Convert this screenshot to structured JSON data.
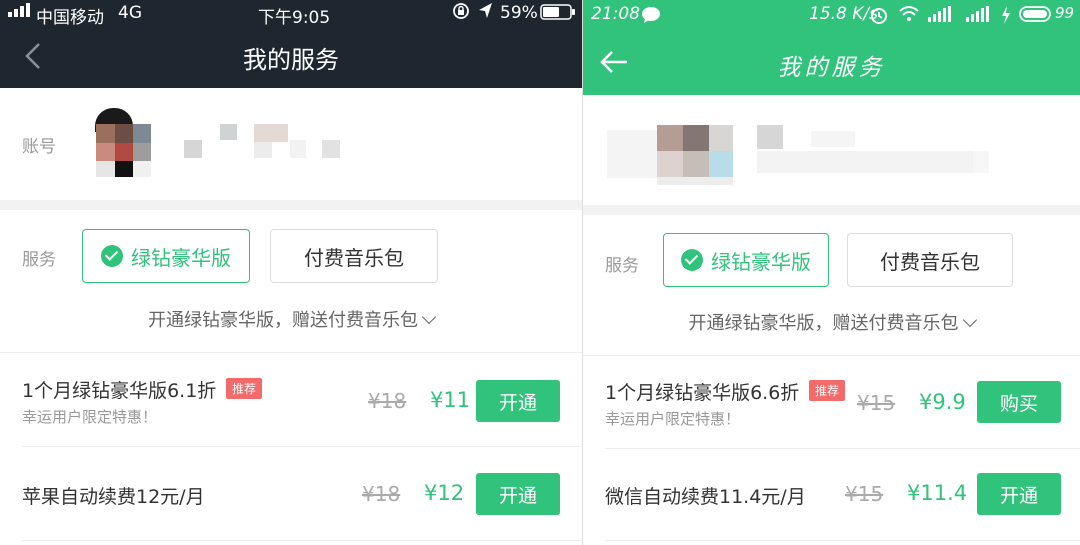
{
  "left": {
    "status": {
      "signal": "中国移动",
      "network": "4G",
      "time": "下午9:05",
      "battery": "59%"
    },
    "title": "我的服务",
    "account_label": "账号",
    "service_label": "服务",
    "services": [
      {
        "label": "绿钻豪华版",
        "selected": true
      },
      {
        "label": "付费音乐包",
        "selected": false
      }
    ],
    "hint": "开通绿钻豪华版，赠送付费音乐包",
    "products": [
      {
        "title": "1个月绿钻豪华版6.1折",
        "tag": "推荐",
        "subtitle": "幸运用户限定特惠！",
        "old_price": "¥18",
        "price": "¥11",
        "button": "开通"
      },
      {
        "title": "苹果自动续费12元/月",
        "tag": "",
        "subtitle": "",
        "old_price": "¥18",
        "price": "¥12",
        "button": "开通"
      }
    ]
  },
  "right": {
    "status": {
      "time": "21:08",
      "speed": "15.8 K/s",
      "battery": "99"
    },
    "title": "我的服务",
    "service_label": "服务",
    "services": [
      {
        "label": "绿钻豪华版",
        "selected": true
      },
      {
        "label": "付费音乐包",
        "selected": false
      }
    ],
    "hint": "开通绿钻豪华版，赠送付费音乐包",
    "products": [
      {
        "title": "1个月绿钻豪华版6.6折",
        "tag": "推荐",
        "subtitle": "幸运用户限定特惠！",
        "old_price": "¥15",
        "price": "¥9.9",
        "button": "购买"
      },
      {
        "title": "微信自动续费11.4元/月",
        "tag": "",
        "subtitle": "",
        "old_price": "¥15",
        "price": "¥11.4",
        "button": "开通"
      }
    ]
  },
  "colors": {
    "green": "#31c27c",
    "dark_header": "#1e2730",
    "tag_red": "#f26a6a"
  }
}
